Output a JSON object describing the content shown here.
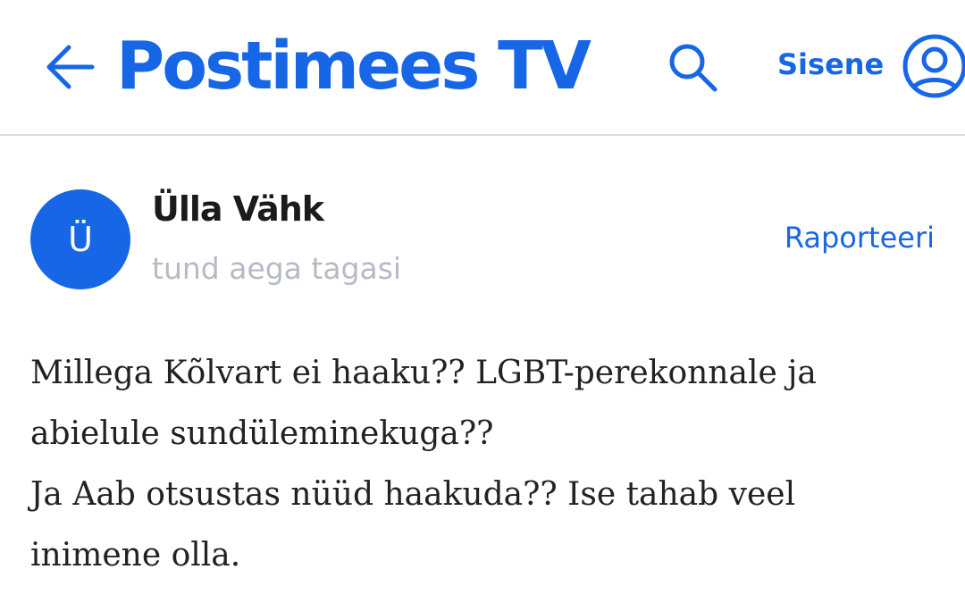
{
  "header": {
    "brand": "Postimees TV",
    "login_label": "Sisene",
    "icons": {
      "back": "arrow-left-icon",
      "search": "search-icon",
      "account": "user-circle-icon"
    },
    "accent_color": "#1666e6"
  },
  "comment": {
    "avatar_initial": "Ü",
    "author": "Ülla Vähk",
    "time": "tund aega tagasi",
    "report_label": "Raporteeri",
    "lines": [
      "Millega Kõlvart ei haaku?? LGBT-perekonnale ja",
      "abielule sundüleminekuga??",
      "Ja Aab otsustas nüüd haakuda?? Ise tahab veel",
      "inimene olla."
    ]
  }
}
